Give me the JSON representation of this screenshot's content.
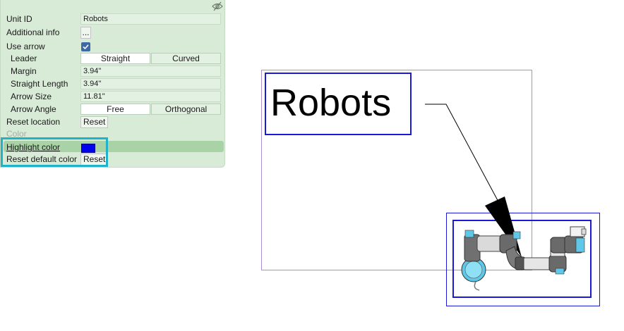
{
  "properties": {
    "unit_id_label": "Unit ID",
    "unit_id_value": "Robots",
    "additional_info_label": "Additional info",
    "additional_info_button": "...",
    "use_arrow_label": "Use arrow",
    "use_arrow_checked": true,
    "leader_label": "Leader",
    "leader_options": [
      "Straight",
      "Curved"
    ],
    "leader_selected": "Straight",
    "margin_label": "Margin",
    "margin_value": "3.94\"",
    "straight_length_label": "Straight Length",
    "straight_length_value": "3.94\"",
    "arrow_size_label": "Arrow Size",
    "arrow_size_value": "11.81\"",
    "arrow_angle_label": "Arrow Angle",
    "arrow_angle_options": [
      "Free",
      "Orthogonal"
    ],
    "arrow_angle_selected": "Free",
    "reset_location_label": "Reset location",
    "reset_button": "Reset",
    "color_section": "Color",
    "highlight_color_label": "Highlight color",
    "highlight_color_value": "#0000ee",
    "reset_default_color_label": "Reset default color",
    "reset_default_button": "Reset"
  },
  "canvas": {
    "annotation_text": "Robots"
  },
  "icons": {
    "panel_toggle": "eye-slash-icon",
    "checkbox": "check-icon"
  },
  "colors": {
    "panel_bg": "#d7ebd6",
    "selection_blue": "#1a1ad6",
    "focus_cyan": "#1fb2c8",
    "frame_purple": "#a98fcf"
  }
}
